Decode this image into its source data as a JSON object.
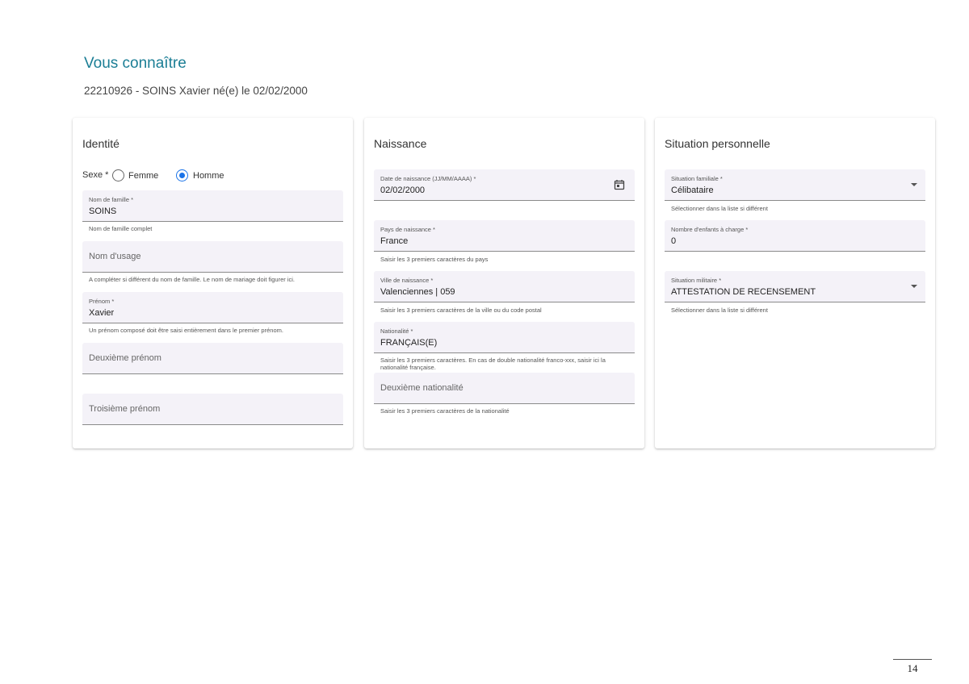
{
  "header": {
    "title": "Vous connaître",
    "subtitle": "22210926 - SOINS Xavier né(e) le 02/02/2000"
  },
  "identite": {
    "title": "Identité",
    "sexe_label": "Sexe *",
    "options": [
      {
        "label": "Femme",
        "checked": false
      },
      {
        "label": "Homme",
        "checked": true
      }
    ],
    "nom_famille": {
      "label": "Nom de famille *",
      "value": "SOINS",
      "hint": "Nom de famille complet"
    },
    "nom_usage": {
      "placeholder": "Nom d'usage",
      "hint": "A compléter si différent du nom de famille. Le nom de mariage doit figurer ici."
    },
    "prenom": {
      "label": "Prénom *",
      "value": "Xavier",
      "hint": "Un prénom composé doit être saisi entièrement dans le premier prénom."
    },
    "deuxieme_prenom": {
      "placeholder": "Deuxième prénom"
    },
    "troisieme_prenom": {
      "placeholder": "Troisième prénom"
    }
  },
  "naissance": {
    "title": "Naissance",
    "date": {
      "label": "Date de naissance (JJ/MM/AAAA) *",
      "value": "02/02/2000",
      "icon": "calendar-icon"
    },
    "pays": {
      "label": "Pays de naissance *",
      "value": "France",
      "hint": "Saisir les 3 premiers caractères du pays"
    },
    "ville": {
      "label": "Ville de naissance *",
      "value": "Valenciennes | 059",
      "hint": "Saisir les 3 premiers caractères de la ville ou du code postal"
    },
    "nationalite": {
      "label": "Nationalité *",
      "value": "FRANÇAIS(E)",
      "hint": "Saisir les 3 premiers caractères. En cas de double nationalité franco-xxx, saisir ici la nationalité française."
    },
    "deuxieme_nationalite": {
      "placeholder": "Deuxième nationalité",
      "hint": "Saisir les 3 premiers caractères de la nationalité"
    }
  },
  "situation": {
    "title": "Situation personnelle",
    "familiale": {
      "label": "Situation familiale *",
      "value": "Célibataire",
      "hint": "Sélectionner dans la liste si différent"
    },
    "enfants": {
      "label": "Nombre d'enfants à charge *",
      "value": "0"
    },
    "militaire": {
      "label": "Situation militaire *",
      "value": "ATTESTATION DE RECENSEMENT",
      "hint": "Sélectionner dans la liste si différent"
    }
  },
  "footer": {
    "page_number": "14"
  },
  "colors": {
    "accent": "#1b7e95",
    "radio": "#1a73e8",
    "field_bg": "#f4f2f8"
  }
}
